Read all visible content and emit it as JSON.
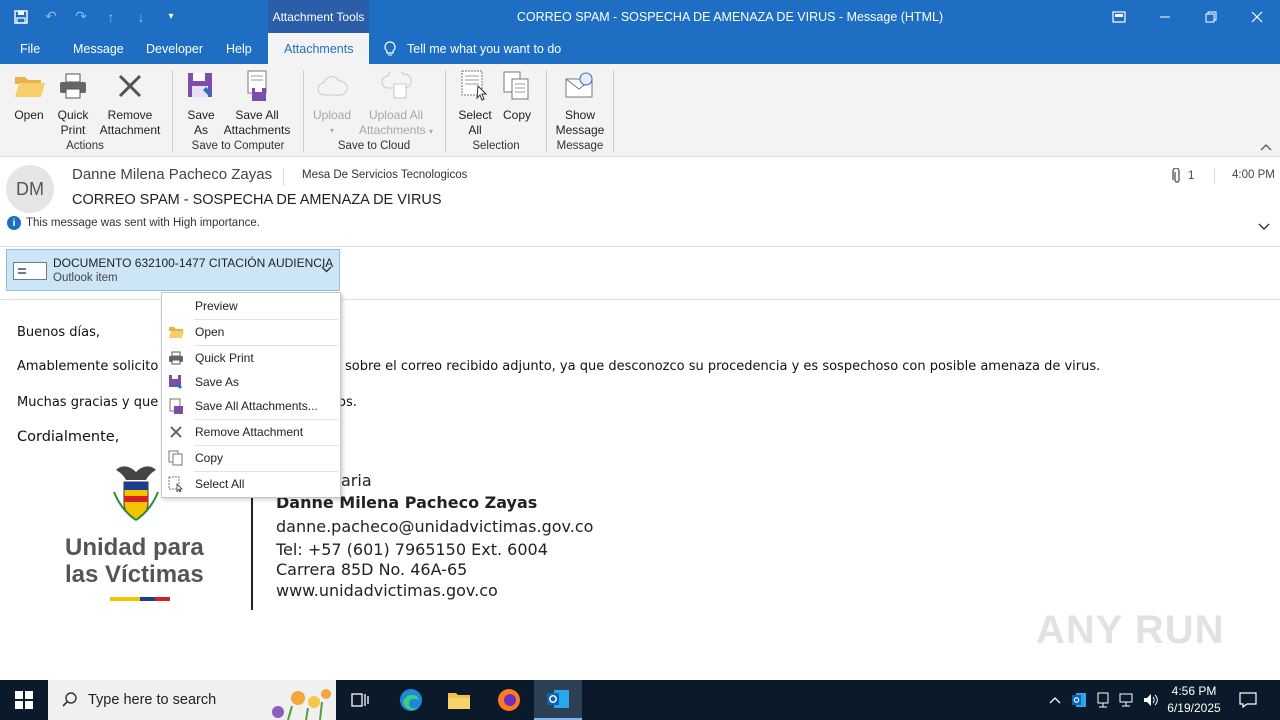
{
  "titlebar": {
    "context_group": "Attachment Tools",
    "title": "CORREO SPAM - SOSPECHA DE AMENAZA DE VIRUS  -  Message (HTML)"
  },
  "tabs": [
    "File",
    "Message",
    "Developer",
    "Help",
    "Attachments"
  ],
  "tell_me": "Tell me what you want to do",
  "ribbon": {
    "actions": {
      "label": "Actions",
      "open": "Open",
      "quick_print": [
        "Quick",
        "Print"
      ],
      "remove": [
        "Remove",
        "Attachment"
      ]
    },
    "save_to_computer": {
      "label": "Save to Computer",
      "save_as": [
        "Save",
        "As"
      ],
      "save_all": [
        "Save All",
        "Attachments"
      ]
    },
    "save_to_cloud": {
      "label": "Save to Cloud",
      "upload": "Upload",
      "upload_all": [
        "Upload All",
        "Attachments"
      ]
    },
    "selection": {
      "label": "Selection",
      "select_all": [
        "Select",
        "All"
      ],
      "copy": "Copy"
    },
    "message": {
      "label": "Message",
      "show_message": [
        "Show",
        "Message"
      ]
    }
  },
  "message": {
    "avatar_initials": "DM",
    "sender": "Danne Milena Pacheco Zayas",
    "to": "Mesa De Servicios Tecnologicos",
    "subject": "CORREO SPAM - SOSPECHA DE AMENAZA DE VIRUS",
    "attachment_count": "1",
    "time": "4:00 PM",
    "importance": "This message was sent with High importance."
  },
  "attachment": {
    "name": "DOCUMENTO 632100-1477 CITACIÓN AUDIENCIA",
    "type": "Outlook item"
  },
  "context_menu": [
    "Preview",
    "Open",
    "Quick Print",
    "Save As",
    "Save All Attachments...",
    "Remove Attachment",
    "Copy",
    "Select All"
  ],
  "body": {
    "greeting": "Buenos días,",
    "line1_start": "Amablemente solicito",
    "line1_end": "sobre el correo recibido adjunto, ya que desconozco su procedencia y es sospechoso con posible amenaza de virus.",
    "line2_start": "Muchas gracias y que",
    "line2_end": "os.",
    "closing": "Cordialmente,"
  },
  "signature": {
    "role_fragment": "aria",
    "name": "Danne Milena Pacheco Zayas",
    "email": "danne.pacheco@unidadvictimas.gov.co",
    "phone": "Tel: +57 (601) 7965150 Ext. 6004",
    "address": "Carrera 85D No. 46A-65",
    "website": "www.unidadvictimas.gov.co",
    "logo_text": [
      "Unidad para",
      "las Víctimas"
    ]
  },
  "watermark": "ANY RUN",
  "taskbar": {
    "search_placeholder": "Type here to search",
    "time": "4:56 PM",
    "date": "6/19/2025"
  },
  "colors": {
    "title_blue": "#1e6fc4",
    "attachment_bg": "#cde6f7",
    "flag": [
      "#f5c400",
      "#1b3f8f",
      "#d32027"
    ]
  }
}
